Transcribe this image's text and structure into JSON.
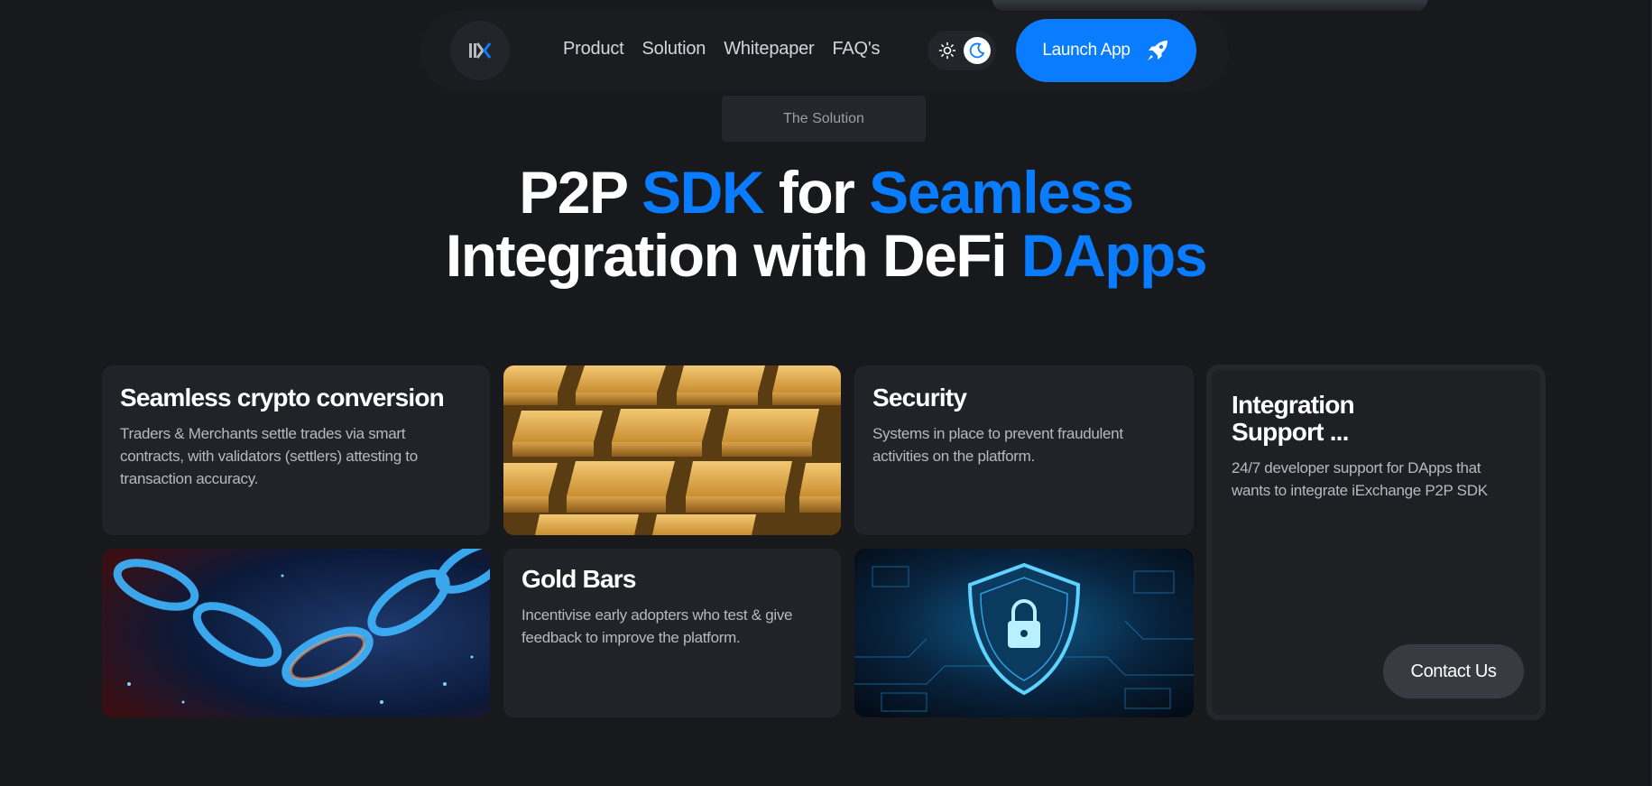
{
  "nav": {
    "links": [
      "Product",
      "Solution",
      "Whitepaper",
      "FAQ's"
    ],
    "launch_label": "Launch App",
    "logo_icon": "ix-logo-icon",
    "theme_icons": [
      "sun-icon",
      "moon-icon"
    ],
    "launch_icon": "rocket-icon"
  },
  "section_tag": "The Solution",
  "hero": {
    "line1": {
      "p2p": "P2P",
      "sdk": "SDK",
      "for": "for",
      "seamless": "Seamless"
    },
    "line2": {
      "integration": "Integration with DeFi",
      "dapps": "DApps"
    }
  },
  "cards": {
    "crypto": {
      "title": "Seamless crypto conversion",
      "desc": "Traders & Merchants settle trades via smart contracts, with validators (settlers) attesting to transaction accuracy."
    },
    "security": {
      "title": "Security",
      "desc": "Systems in place to prevent fraudulent activities on the platform."
    },
    "integration": {
      "title": "Integration Support ...",
      "desc": "24/7 developer support for DApps that wants to integrate iExchange P2P SDK",
      "button": "Contact Us"
    },
    "gold": {
      "title": "Gold Bars",
      "desc": "Incentivise early adopters who test & give feedback to improve the platform."
    }
  },
  "images": [
    "gold-bars-image",
    "blockchain-chain-image",
    "security-shield-image"
  ],
  "colors": {
    "background": "#18191c",
    "card": "#212328",
    "accent": "#0a7cff",
    "text": "#ffffff",
    "muted": "#b5b9c1"
  }
}
